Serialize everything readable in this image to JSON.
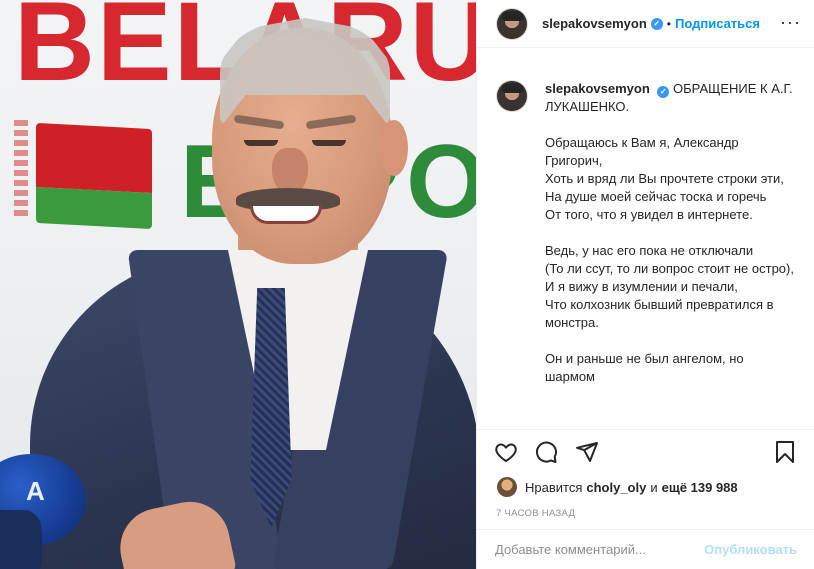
{
  "photo": {
    "bg_word_top": "BELARUS",
    "bg_word_bottom": "EXPO",
    "mic_logo": "A"
  },
  "header": {
    "username": "slepakovsemyon",
    "separator": "•",
    "follow_label": "Подписаться",
    "more_label": "···"
  },
  "caption": {
    "username": "slepakovsemyon",
    "title": "ОБРАЩЕНИЕ К А.Г. ЛУКАШЕНКО.",
    "body": "\nОбращаюсь к Вам я, Александр Григорич,\nХоть и вряд ли Вы прочтете строки эти,\nНа душе моей сейчас тоска и горечь\nОт того, что я увидел в интернете.\n\nВедь, у нас его пока не отключали\n(То ли ссут, то ли вопрос стоит не остро),\nИ я вижу в изумлении и печали,\nЧто колхозник бывший превратился в монстра.\n\nОн и раньше не был ангелом, но шармом"
  },
  "likes": {
    "prefix": "Нравится",
    "liker": "choly_oly",
    "and": "и",
    "others": "ещё 139 988"
  },
  "time_ago": "7 ЧАСОВ НАЗАД",
  "comment": {
    "placeholder": "Добавьте комментарий...",
    "post_label": "Опубликовать"
  },
  "icons": {
    "like": "heart-icon",
    "comment": "comment-icon",
    "share": "paper-plane-icon",
    "save": "bookmark-icon",
    "verified": "verified-badge-icon"
  },
  "colors": {
    "accent": "#0095f6",
    "post_disabled": "#b2dffc",
    "verified": "#3897f0",
    "muted": "#8e8e8e"
  }
}
